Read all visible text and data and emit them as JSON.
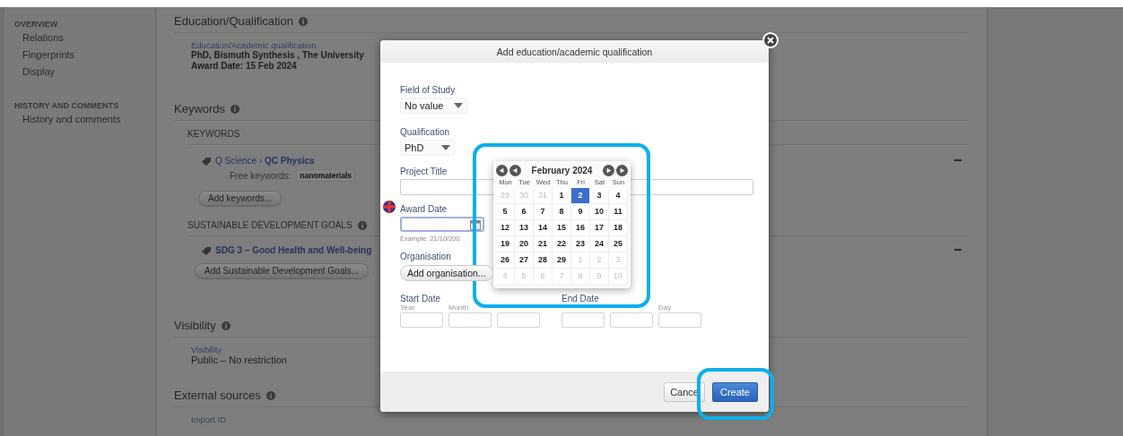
{
  "sidebar": {
    "sections": [
      {
        "heading": "OVERVIEW",
        "items": [
          {
            "label": "Relations"
          },
          {
            "label": "Fingerprints"
          },
          {
            "label": "Display"
          }
        ]
      },
      {
        "heading": "HISTORY AND COMMENTS",
        "items": [
          {
            "label": "History and comments"
          }
        ]
      }
    ]
  },
  "education": {
    "heading": "Education/Qualification",
    "label": "Education/Academic qualification",
    "lines": [
      "PhD, Bismuth Synthesis , The University",
      "Award Date: 15 Feb 2024"
    ]
  },
  "keywords": {
    "heading": "Keywords",
    "subheading": "KEYWORDS",
    "path": "Q Science › **QC Physics**",
    "free_label": "Free keywords:",
    "free_value": "nanomaterials",
    "button": "Add keywords..."
  },
  "sdg": {
    "heading": "SUSTAINABLE DEVELOPMENT GOALS",
    "tag": "SDG 3 – Good Health and Well-being",
    "button": "Add Sustainable Development Goals..."
  },
  "visibility": {
    "heading": "Visibility",
    "label": "Visibility",
    "value": "Public – No restriction"
  },
  "external": {
    "heading": "External sources",
    "label": "Import ID"
  },
  "dialog": {
    "title": "Add education/academic qualification",
    "field_of_study": {
      "label": "Field of Study",
      "value": "No value"
    },
    "qualification": {
      "label": "Qualification",
      "value": "PhD"
    },
    "project_title": {
      "label": "Project Title"
    },
    "award_date": {
      "label": "Award Date",
      "hint": "Example: 21/10/200"
    },
    "organisation": {
      "label": "Organisation",
      "button": "Add organisation..."
    },
    "start_date": {
      "label": "Start Date",
      "parts": [
        {
          "kind": "labeled",
          "label": "Year"
        },
        {
          "kind": "labeled",
          "label": "Month"
        },
        {
          "kind": "unlabeled"
        }
      ]
    },
    "end_date": {
      "label": "End Date",
      "parts": [
        {
          "kind": "unlabeled"
        },
        {
          "kind": "unlabeled"
        },
        {
          "kind": "labeled",
          "label": "Day"
        }
      ]
    },
    "buttons": [
      {
        "label": "Cance",
        "kind": "secondary"
      },
      {
        "label": "Create",
        "kind": "primary"
      }
    ]
  },
  "calendar": {
    "title": "February 2024",
    "weekdays": [
      "Mon",
      "Tue",
      "Wed",
      "Thu",
      "Fri",
      "Sat",
      "Sun"
    ],
    "weeks": [
      [
        {
          "day": "29",
          "kind": "other",
          "selected": false
        },
        {
          "day": "30",
          "kind": "other",
          "selected": false
        },
        {
          "day": "31",
          "kind": "other",
          "selected": false
        },
        {
          "day": "1",
          "kind": "current",
          "selected": false
        },
        {
          "day": "2",
          "kind": "current",
          "selected": true
        },
        {
          "day": "3",
          "kind": "current",
          "selected": false
        },
        {
          "day": "4",
          "kind": "current",
          "selected": false
        }
      ],
      [
        {
          "day": "5",
          "kind": "current",
          "selected": false
        },
        {
          "day": "6",
          "kind": "current",
          "selected": false
        },
        {
          "day": "7",
          "kind": "current",
          "selected": false
        },
        {
          "day": "8",
          "kind": "current",
          "selected": false
        },
        {
          "day": "9",
          "kind": "current",
          "selected": false
        },
        {
          "day": "10",
          "kind": "current",
          "selected": false
        },
        {
          "day": "11",
          "kind": "current",
          "selected": false
        }
      ],
      [
        {
          "day": "12",
          "kind": "current",
          "selected": false
        },
        {
          "day": "13",
          "kind": "current",
          "selected": false
        },
        {
          "day": "14",
          "kind": "current",
          "selected": false
        },
        {
          "day": "15",
          "kind": "current",
          "selected": false
        },
        {
          "day": "16",
          "kind": "current",
          "selected": false
        },
        {
          "day": "17",
          "kind": "current",
          "selected": false
        },
        {
          "day": "18",
          "kind": "current",
          "selected": false
        }
      ],
      [
        {
          "day": "19",
          "kind": "current",
          "selected": false
        },
        {
          "day": "20",
          "kind": "current",
          "selected": false
        },
        {
          "day": "21",
          "kind": "current",
          "selected": false
        },
        {
          "day": "22",
          "kind": "current",
          "selected": false
        },
        {
          "day": "23",
          "kind": "current",
          "selected": false
        },
        {
          "day": "24",
          "kind": "current",
          "selected": false
        },
        {
          "day": "25",
          "kind": "current",
          "selected": false
        }
      ],
      [
        {
          "day": "26",
          "kind": "current",
          "selected": false
        },
        {
          "day": "27",
          "kind": "current",
          "selected": false
        },
        {
          "day": "28",
          "kind": "current",
          "selected": false
        },
        {
          "day": "29",
          "kind": "current",
          "selected": false
        },
        {
          "day": "1",
          "kind": "other",
          "selected": false
        },
        {
          "day": "2",
          "kind": "other",
          "selected": false
        },
        {
          "day": "3",
          "kind": "other",
          "selected": false
        }
      ],
      [
        {
          "day": "4",
          "kind": "other",
          "selected": false
        },
        {
          "day": "5",
          "kind": "other",
          "selected": false
        },
        {
          "day": "6",
          "kind": "other",
          "selected": false
        },
        {
          "day": "7",
          "kind": "other",
          "selected": false
        },
        {
          "day": "8",
          "kind": "other",
          "selected": false
        },
        {
          "day": "9",
          "kind": "other",
          "selected": false
        },
        {
          "day": "10",
          "kind": "other",
          "selected": false
        }
      ]
    ]
  }
}
